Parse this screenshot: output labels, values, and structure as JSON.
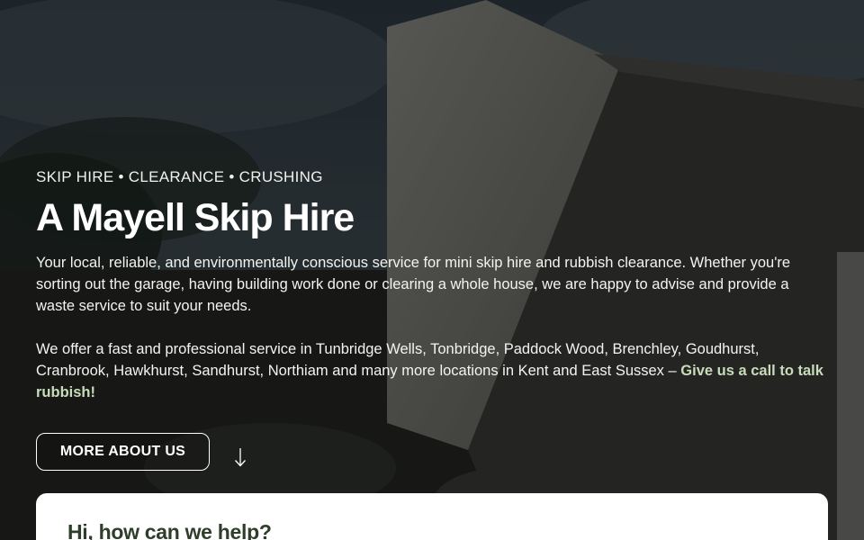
{
  "hero": {
    "tagline": "SKIP HIRE • CLEARANCE • CRUSHING",
    "title": "A Mayell Skip Hire",
    "intro": "Your local, reliable, and environmentally conscious service for mini skip hire and rubbish clearance.  Whether you're sorting out the garage, having building work done or clearing a whole house, we are happy to advise and provide a waste service to suit your needs.",
    "locations": "We offer a fast and professional service in Tunbridge Wells, Tonbridge, Paddock Wood, Brenchley, Goudhurst, Cranbrook, Hawkhurst, Sandhurst, Northiam and many more locations in Kent and East Sussex – ",
    "call_to_action": "Give us a call to talk rubbish!",
    "about_button": "MORE ABOUT US"
  },
  "help_card": {
    "title": "Hi, how can we help?"
  },
  "colors": {
    "accent_green": "#c9dcb9",
    "card_heading": "#2f3e2a"
  },
  "icons": {
    "scroll": "arrow-down-icon"
  }
}
